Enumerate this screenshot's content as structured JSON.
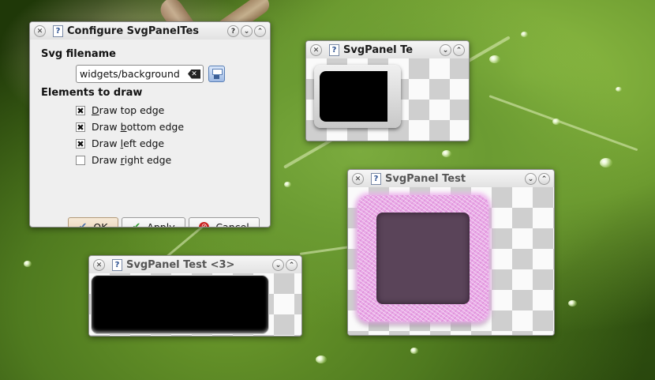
{
  "config_dialog": {
    "title": "Configure SvgPanelTes",
    "svg_filename_label": "Svg filename",
    "svg_filename_value": "widgets/background",
    "elements_label": "Elements to draw",
    "checkboxes": [
      {
        "pre": "",
        "key": "D",
        "post": "raw top edge",
        "checked": true
      },
      {
        "pre": "Draw ",
        "key": "b",
        "post": "ottom edge",
        "checked": true
      },
      {
        "pre": "Draw ",
        "key": "l",
        "post": "eft edge",
        "checked": true
      },
      {
        "pre": "Draw ",
        "key": "r",
        "post": "ight edge",
        "checked": false
      }
    ],
    "ok": {
      "key": "O",
      "rest": "K"
    },
    "apply": {
      "key": "A",
      "rest": "pply"
    },
    "cancel": {
      "key": "C",
      "rest": "ancel"
    }
  },
  "test_windows": {
    "top_right_title": "SvgPanel Te",
    "mid_right_title": "SvgPanel Test",
    "bottom_left_title": "SvgPanel Test <3>"
  },
  "colors": {
    "accent_default_button": "#e5cfb2",
    "checker_dark": "#cfcfcf",
    "furry_frame": "#e8a8e6",
    "panel_inner": "#5a4459"
  },
  "icons": {
    "close": "close-icon",
    "help": "help-icon",
    "minimize": "minimize-icon",
    "maximize": "maximize-icon",
    "clear": "clear-icon",
    "save": "save-icon"
  }
}
